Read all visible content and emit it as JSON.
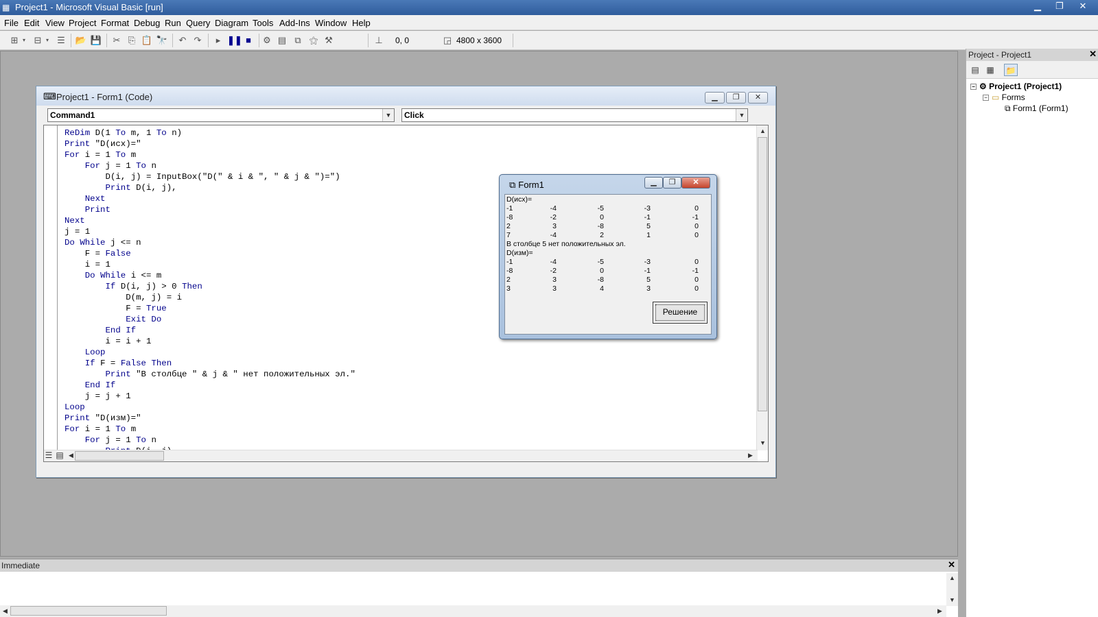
{
  "window": {
    "title": "Project1 - Microsoft Visual Basic [run]"
  },
  "menu": [
    "File",
    "Edit",
    "View",
    "Project",
    "Format",
    "Debug",
    "Run",
    "Query",
    "Diagram",
    "Tools",
    "Add-Ins",
    "Window",
    "Help"
  ],
  "toolbar": {
    "position": "0, 0",
    "size": "4800 x 3600"
  },
  "code_window": {
    "title": "Project1 - Form1 (Code)",
    "object_combo": "Command1",
    "proc_combo": "Click",
    "lines": [
      "ReDim D(1 To m, 1 To n)",
      "Print \"D(исх)=\"",
      "For i = 1 To m",
      "    For j = 1 To n",
      "        D(i, j) = InputBox(\"D(\" & i & \", \" & j & \")=\")",
      "        Print D(i, j),",
      "    Next",
      "    Print",
      "Next",
      "j = 1",
      "Do While j <= n",
      "    F = False",
      "    i = 1",
      "    Do While i <= m",
      "        If D(i, j) > 0 Then",
      "            D(m, j) = i",
      "            F = True",
      "            Exit Do",
      "        End If",
      "        i = i + 1",
      "    Loop",
      "    If F = False Then",
      "        Print \"В столбце \" & j & \" нет положительных эл.\"",
      "    End If",
      "    j = j + 1",
      "Loop",
      "Print \"D(изм)=\"",
      "For i = 1 To m",
      "    For j = 1 To n",
      "        Print D(i, j),"
    ]
  },
  "form1": {
    "title": "Form1",
    "header1": "D(исх)=",
    "matrix1": [
      [
        "-1",
        "-4",
        "-5",
        "-3",
        "0"
      ],
      [
        "-8",
        "-2",
        "0",
        "-1",
        "-1"
      ],
      [
        "2",
        "3",
        "-8",
        "5",
        "0"
      ],
      [
        "7",
        "-4",
        "2",
        "1",
        "0"
      ]
    ],
    "message": "В столбце 5 нет положительных эл.",
    "header2": "D(изм)=",
    "matrix2": [
      [
        "-1",
        "-4",
        "-5",
        "-3",
        "0"
      ],
      [
        "-8",
        "-2",
        "0",
        "-1",
        "-1"
      ],
      [
        "2",
        "3",
        "-8",
        "5",
        "0"
      ],
      [
        "3",
        "3",
        "4",
        "3",
        "0"
      ]
    ],
    "button": "Решение"
  },
  "project_explorer": {
    "title": "Project - Project1",
    "project": "Project1 (Project1)",
    "folder": "Forms",
    "form": "Form1 (Form1)"
  },
  "immediate": {
    "title": "Immediate"
  }
}
